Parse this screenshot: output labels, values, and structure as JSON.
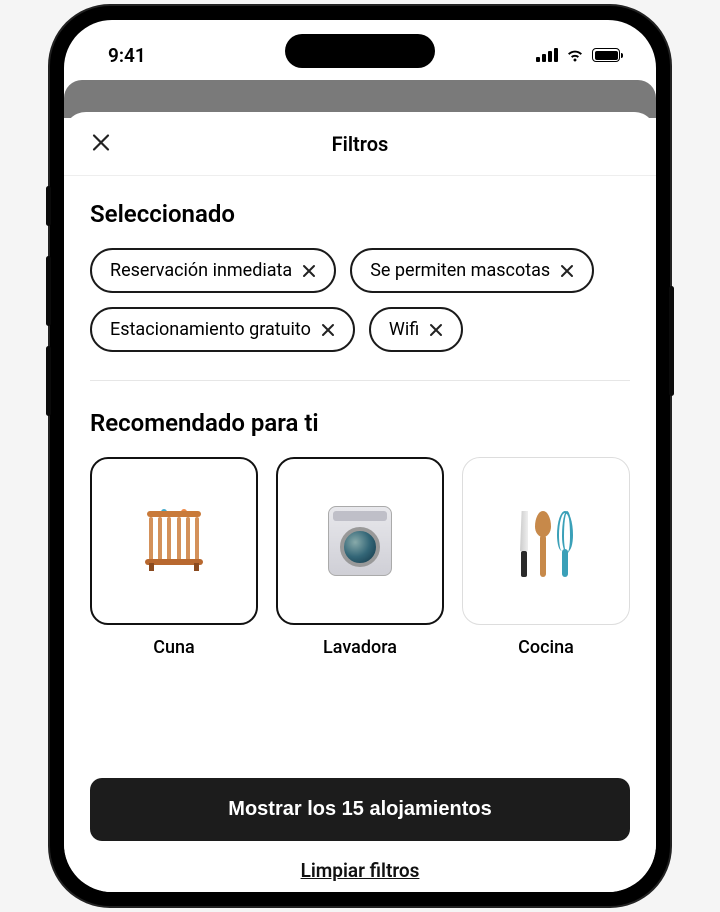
{
  "status": {
    "time": "9:41"
  },
  "sheet": {
    "title": "Filtros"
  },
  "selected": {
    "title": "Seleccionado",
    "chips": [
      {
        "label": "Reservación inmediata"
      },
      {
        "label": "Se permiten mascotas"
      },
      {
        "label": "Estacionamiento gratuito"
      },
      {
        "label": "Wifi"
      }
    ]
  },
  "recommended": {
    "title": "Recomendado para ti",
    "items": [
      {
        "label": "Cuna",
        "selected": true,
        "icon": "crib"
      },
      {
        "label": "Lavadora",
        "selected": true,
        "icon": "washer"
      },
      {
        "label": "Cocina",
        "selected": false,
        "icon": "kitchen"
      }
    ]
  },
  "footer": {
    "show_button": "Mostrar los 15 alojamientos",
    "result_count": 15,
    "clear_label": "Limpiar filtros"
  }
}
